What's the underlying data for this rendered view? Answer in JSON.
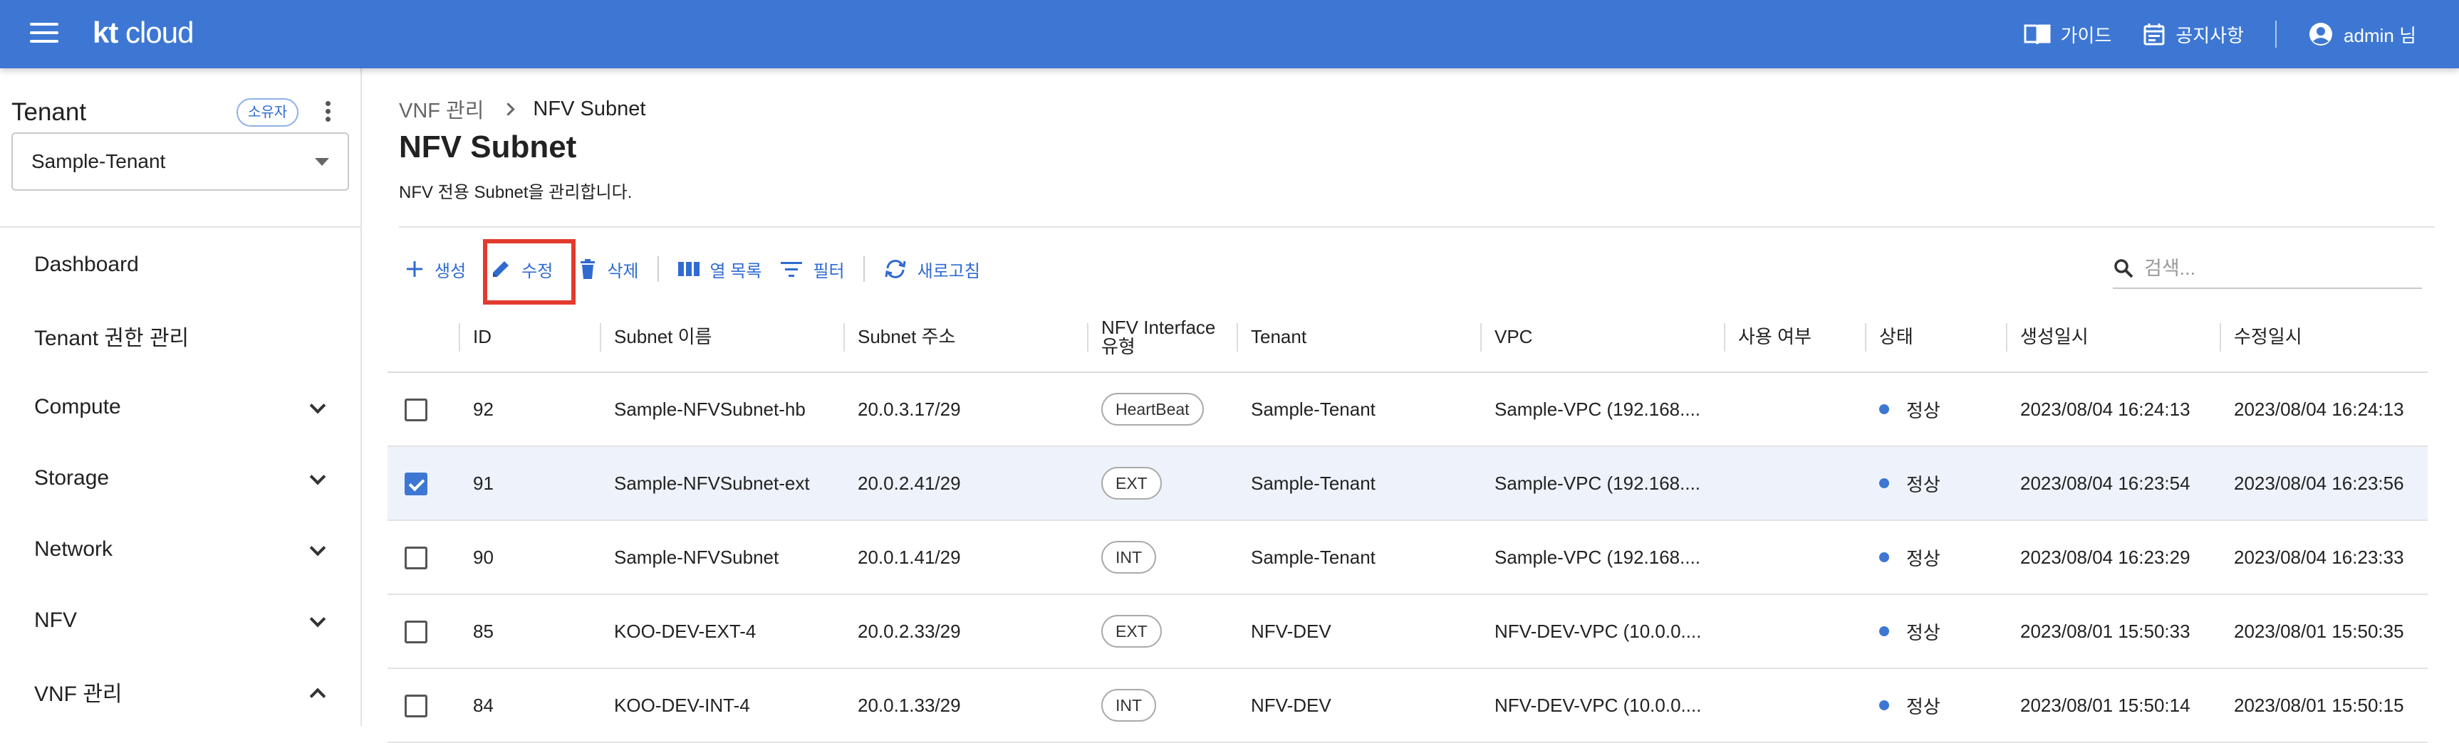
{
  "header": {
    "logo_kt": "kt",
    "logo_cloud": "cloud",
    "guide_label": "가이드",
    "notice_label": "공지사항",
    "user_label": "admin 님",
    "bar_color": "#3d77d3"
  },
  "sidebar": {
    "tenant_title": "Tenant",
    "owner_badge": "소유자",
    "selected_tenant": "Sample-Tenant",
    "items": [
      {
        "label": "Dashboard"
      },
      {
        "label": "Tenant 권한 관리"
      },
      {
        "label": "Compute",
        "icon": "chevron-down-icon"
      },
      {
        "label": "Storage",
        "icon": "chevron-down-icon"
      },
      {
        "label": "Network",
        "icon": "chevron-down-icon"
      },
      {
        "label": "NFV",
        "icon": "chevron-down-icon"
      },
      {
        "label": "VNF 관리",
        "icon": "chevron-up-icon"
      }
    ]
  },
  "breadcrumb": {
    "parent": "VNF 관리",
    "current": "NFV Subnet"
  },
  "page": {
    "title": "NFV Subnet",
    "description": "NFV 전용 Subnet을 관리합니다."
  },
  "toolbar": {
    "create_label": "생성",
    "edit_label": "수정",
    "delete_label": "삭제",
    "columns_label": "열 목록",
    "filter_label": "필터",
    "refresh_label": "새로고침",
    "accent_color": "#2f6bd1",
    "highlight_color": "#e23b2e"
  },
  "search": {
    "placeholder": "검색..."
  },
  "table": {
    "columns": {
      "id": "ID",
      "name": "Subnet 이름",
      "address": "Subnet 주소",
      "nfv_type_line1": "NFV Interface",
      "nfv_type_line2": "유형",
      "tenant": "Tenant",
      "vpc": "VPC",
      "in_use": "사용 여부",
      "status": "상태",
      "created": "생성일시",
      "modified": "수정일시"
    },
    "rows": [
      {
        "checked": false,
        "id": "92",
        "name": "Sample-NFVSubnet-hb",
        "address": "20.0.3.17/29",
        "type": "HeartBeat",
        "tenant": "Sample-Tenant",
        "vpc": "Sample-VPC (192.168....",
        "in_use": "",
        "status": "정상",
        "created": "2023/08/04 16:24:13",
        "modified": "2023/08/04 16:24:13"
      },
      {
        "checked": true,
        "id": "91",
        "name": "Sample-NFVSubnet-ext",
        "address": "20.0.2.41/29",
        "type": "EXT",
        "tenant": "Sample-Tenant",
        "vpc": "Sample-VPC (192.168....",
        "in_use": "",
        "status": "정상",
        "created": "2023/08/04 16:23:54",
        "modified": "2023/08/04 16:23:56"
      },
      {
        "checked": false,
        "id": "90",
        "name": "Sample-NFVSubnet",
        "address": "20.0.1.41/29",
        "type": "INT",
        "tenant": "Sample-Tenant",
        "vpc": "Sample-VPC (192.168....",
        "in_use": "",
        "status": "정상",
        "created": "2023/08/04 16:23:29",
        "modified": "2023/08/04 16:23:33"
      },
      {
        "checked": false,
        "id": "85",
        "name": "KOO-DEV-EXT-4",
        "address": "20.0.2.33/29",
        "type": "EXT",
        "tenant": "NFV-DEV",
        "vpc": "NFV-DEV-VPC (10.0.0....",
        "in_use": "",
        "status": "정상",
        "created": "2023/08/01 15:50:33",
        "modified": "2023/08/01 15:50:35"
      },
      {
        "checked": false,
        "id": "84",
        "name": "KOO-DEV-INT-4",
        "address": "20.0.1.33/29",
        "type": "INT",
        "tenant": "NFV-DEV",
        "vpc": "NFV-DEV-VPC (10.0.0....",
        "in_use": "",
        "status": "정상",
        "created": "2023/08/01 15:50:14",
        "modified": "2023/08/01 15:50:15"
      }
    ],
    "status_color": "#3d77d3",
    "selected_row_color": "#eef3fb"
  }
}
